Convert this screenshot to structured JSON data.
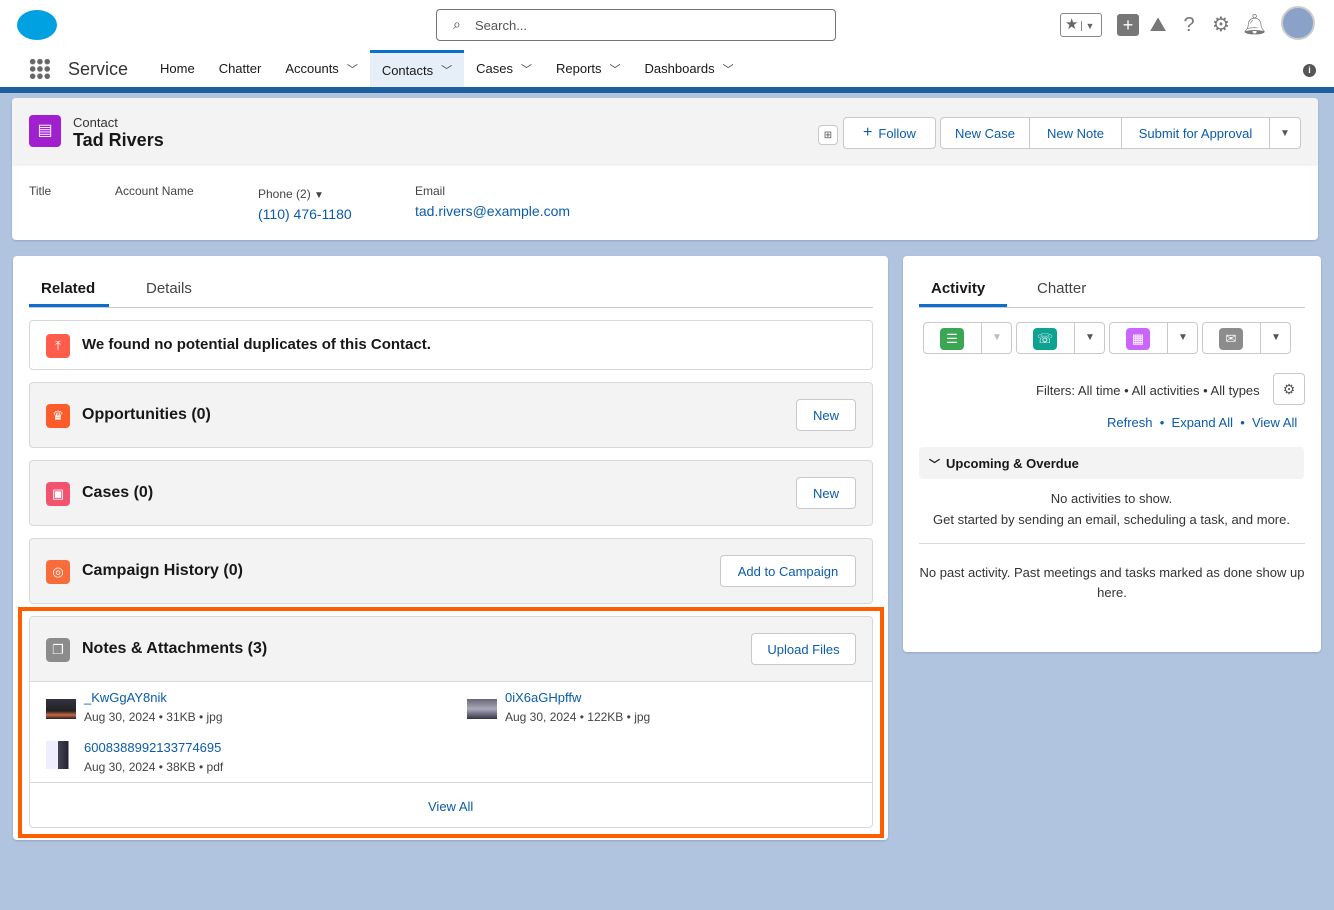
{
  "header": {
    "search_placeholder": "Search...",
    "app_name": "Service"
  },
  "nav": [
    {
      "label": "Home",
      "dropdown": false
    },
    {
      "label": "Chatter",
      "dropdown": false
    },
    {
      "label": "Accounts",
      "dropdown": true
    },
    {
      "label": "Contacts",
      "dropdown": true,
      "active": true
    },
    {
      "label": "Cases",
      "dropdown": true
    },
    {
      "label": "Reports",
      "dropdown": true
    },
    {
      "label": "Dashboards",
      "dropdown": true
    }
  ],
  "record": {
    "object_label": "Contact",
    "name": "Tad Rivers",
    "actions": {
      "follow": "Follow",
      "new_case": "New Case",
      "new_note": "New Note",
      "submit": "Submit for Approval"
    },
    "fields": {
      "title_label": "Title",
      "account_label": "Account Name",
      "phone_label": "Phone (2)",
      "phone": "(110) 476-1180",
      "email_label": "Email",
      "email": "tad.rivers@example.com"
    }
  },
  "left": {
    "tabs": [
      "Related",
      "Details"
    ],
    "duplicates": "We found no potential duplicates of this Contact.",
    "opportunities": {
      "title": "Opportunities (0)",
      "button": "New"
    },
    "cases": {
      "title": "Cases (0)",
      "button": "New"
    },
    "campaign": {
      "title": "Campaign History (0)",
      "button": "Add to Campaign"
    },
    "notes": {
      "title": "Notes & Attachments (3)",
      "button": "Upload Files",
      "view_all": "View All",
      "files": [
        {
          "name": "_KwGgAY8nik",
          "date": "Aug 30, 2024",
          "size": "31KB",
          "type": "jpg"
        },
        {
          "name": "0iX6aGHpffw",
          "date": "Aug 30, 2024",
          "size": "122KB",
          "type": "jpg"
        },
        {
          "name": "6008388992133774695",
          "date": "Aug 30, 2024",
          "size": "38KB",
          "type": "pdf"
        }
      ]
    }
  },
  "right": {
    "tabs": [
      "Activity",
      "Chatter"
    ],
    "filters": "Filters: All time • All activities • All types",
    "links": [
      "Refresh",
      "Expand All",
      "View All"
    ],
    "upcoming": "Upcoming & Overdue",
    "no_activities": "No activities to show.",
    "get_started": "Get started by sending an email, scheduling a task, and more.",
    "no_past": "No past activity. Past meetings and tasks marked as done show up here."
  },
  "colors": {
    "brand": "#00a1e0",
    "highlight": "#ff5d00",
    "link": "#0b5cab"
  }
}
